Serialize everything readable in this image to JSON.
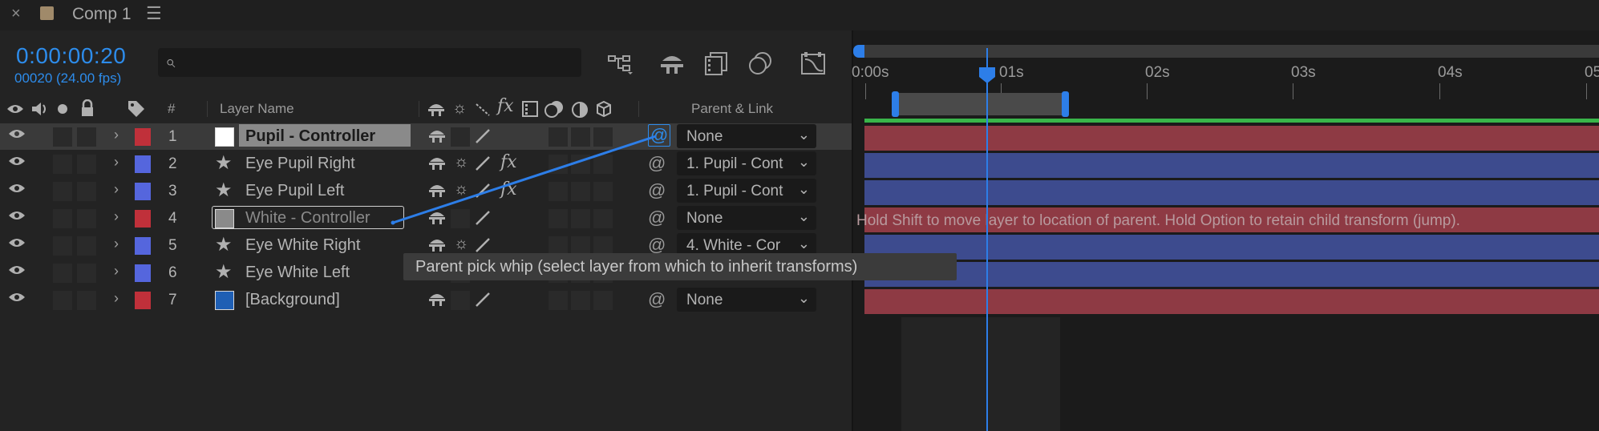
{
  "tab": {
    "close_label": "×",
    "title": "Comp 1",
    "menu_label": "☰",
    "swatch_color": "#a08a6a"
  },
  "time": {
    "timecode": "0:00:00:20",
    "frames": "00020 (24.00 fps)"
  },
  "columns": {
    "number": "#",
    "layer_name": "Layer Name",
    "parent_link": "Parent & Link"
  },
  "icons": [
    "eye-icon",
    "audio-icon",
    "solo-icon",
    "lock-icon",
    "label-tag-icon",
    "shy-icon",
    "collapse-icon",
    "quality-icon",
    "fx-icon",
    "frame-blend-icon",
    "motion-blur-icon",
    "adjustment-icon",
    "3d-icon",
    "pick-whip-icon",
    "search-icon"
  ],
  "layers": [
    {
      "num": "1",
      "name": "Pupil - Controller",
      "label_color": "#c0303a",
      "type_color": "#ffffff",
      "type": "solid",
      "parent": "None",
      "selected": true,
      "fx": false
    },
    {
      "num": "2",
      "name": "Eye Pupil Right",
      "label_color": "#5566dd",
      "type": "star",
      "parent": "1. Pupil - Cont",
      "selected": false,
      "fx": true
    },
    {
      "num": "3",
      "name": "Eye Pupil Left",
      "label_color": "#5566dd",
      "type": "star",
      "parent": "1. Pupil - Cont",
      "selected": false,
      "fx": true
    },
    {
      "num": "4",
      "name": "White - Controller",
      "label_color": "#c0303a",
      "type_color": "#8a8a8a",
      "type": "solid",
      "parent": "None",
      "selected": false,
      "fx": false
    },
    {
      "num": "5",
      "name": "Eye White Right",
      "label_color": "#5566dd",
      "type": "star",
      "parent": "4. White - Cor",
      "selected": false,
      "fx": false
    },
    {
      "num": "6",
      "name": "Eye White Left",
      "label_color": "#5566dd",
      "type": "star",
      "parent": "",
      "selected": false,
      "fx": false
    },
    {
      "num": "7",
      "name": "[Background]",
      "label_color": "#c0303a",
      "type_color": "#1f5fb4",
      "type": "solid",
      "parent": "None",
      "selected": false,
      "fx": false
    }
  ],
  "ruler": [
    "0:00s",
    "01s",
    "02s",
    "03s",
    "04s",
    "05"
  ],
  "hint": "Hold Shift to move layer to location of parent. Hold Option to retain child transform (jump).",
  "tooltip": "Parent pick whip (select layer from which to inherit transforms)",
  "colors": {
    "accent": "#2d8ceb",
    "layer_red": "#8e3a44",
    "layer_blue": "#3d4b8e",
    "work_area_green": "#39b54a"
  }
}
